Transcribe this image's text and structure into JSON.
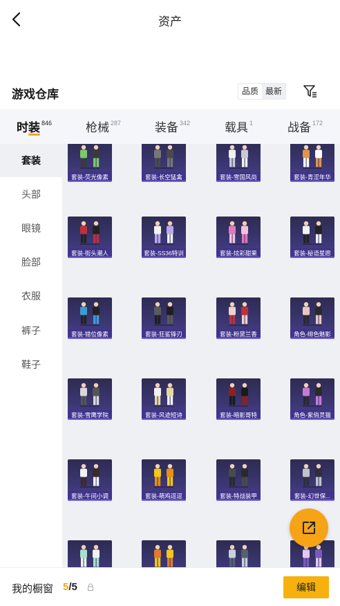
{
  "header": {
    "title": "资产",
    "back_icon": "chevron-left-icon"
  },
  "warehouse": {
    "title": "游戏仓库",
    "sort_options": [
      "品质",
      "最新"
    ],
    "sort_selected": "最新",
    "filter_icon": "filter-icon"
  },
  "tabs": [
    {
      "label": "时装",
      "count": "846",
      "active": true
    },
    {
      "label": "枪械",
      "count": "287",
      "active": false
    },
    {
      "label": "装备",
      "count": "342",
      "active": false
    },
    {
      "label": "载具",
      "count": "1",
      "active": false
    },
    {
      "label": "战备",
      "count": "172",
      "active": false
    }
  ],
  "sidebar": {
    "items": [
      {
        "label": "套装",
        "active": true
      },
      {
        "label": "头部",
        "active": false
      },
      {
        "label": "眼镜",
        "active": false
      },
      {
        "label": "脸部",
        "active": false
      },
      {
        "label": "衣服",
        "active": false
      },
      {
        "label": "裤子",
        "active": false
      },
      {
        "label": "鞋子",
        "active": false
      }
    ]
  },
  "items": [
    "套装-荧光像素",
    "套装-长空猛禽",
    "套装-雪国风尚",
    "套装-青涩年华",
    "套装-街头潮人",
    "套装-SS36特训",
    "套装-炫彩甜果",
    "套装-秘语星愿",
    "套装-错位像素",
    "套装-狂鲨锋刃",
    "套装-粉黛兰香",
    "角色-绯色魅影",
    "套装-雪鹰学院",
    "套装-风迹短诗",
    "套装-暗影哥特",
    "角色-紫俏灵猫",
    "套装-午间小调",
    "套装-萌鸡逗逗",
    "套装-特战装甲",
    "套装-幻世保...",
    "",
    "",
    "",
    ""
  ],
  "fab": {
    "icon": "share-external-icon"
  },
  "showcase": {
    "label": "我的橱窗",
    "current": "5",
    "separator": "/",
    "max": "5",
    "lock_icon": "lock-icon",
    "edit_label": "编辑"
  },
  "colors": {
    "accent": "#f5a623",
    "card_bg": "#3a3671",
    "button": "#f7b10f"
  }
}
